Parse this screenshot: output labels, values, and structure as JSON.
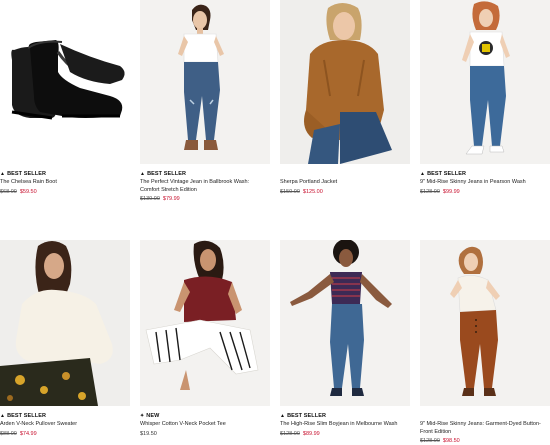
{
  "products": [
    {
      "badge": "BEST SELLER",
      "badge_icon": "star-icon",
      "name": "The Chelsea Rain Boot",
      "old_price": "$68.00",
      "price": "$59.50",
      "price_style": "sale"
    },
    {
      "badge": "BEST SELLER",
      "badge_icon": "star-icon",
      "name": "The Perfect Vintage Jean in Ballbrook Wash: Comfort Stretch Edition",
      "old_price": "$130.00",
      "price": "$79.99",
      "price_style": "sale"
    },
    {
      "badge": "",
      "badge_icon": "",
      "name": "Sherpa Portland Jacket",
      "old_price": "$150.00",
      "price": "$125.00",
      "price_style": "sale"
    },
    {
      "badge": "BEST SELLER",
      "badge_icon": "star-icon",
      "name": "9\" Mid-Rise Skinny Jeans in Pearson Wash",
      "old_price": "$128.00",
      "price": "$99.99",
      "price_style": "sale"
    },
    {
      "badge": "BEST SELLER",
      "badge_icon": "star-icon",
      "name": "Arden V-Neck Pullover Sweater",
      "old_price": "$88.00",
      "price": "$74.99",
      "price_style": "sale"
    },
    {
      "badge": "NEW",
      "badge_icon": "sparkle-icon",
      "name": "Whisper Cotton V-Neck Pocket Tee",
      "old_price": "",
      "price": "$19.50",
      "price_style": "regular"
    },
    {
      "badge": "BEST SELLER",
      "badge_icon": "star-icon",
      "name": "The High-Rise Slim Boyjean in Melbourne Wash",
      "old_price": "$128.00",
      "price": "$89.99",
      "price_style": "sale"
    },
    {
      "badge": "",
      "badge_icon": "",
      "name": "9\" Mid-Rise Skinny Jeans: Garment-Dyed Button-Front Edition",
      "old_price": "$128.00",
      "price": "$98.50",
      "price_style": "sale"
    }
  ],
  "colors": {
    "sale": "#c8102e",
    "text": "#111111"
  }
}
